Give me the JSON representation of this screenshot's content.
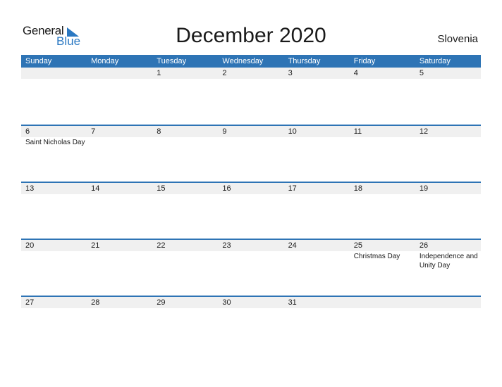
{
  "logo": {
    "general": "General",
    "blue": "Blue"
  },
  "header": {
    "title": "December 2020",
    "country": "Slovenia"
  },
  "colors": {
    "accent": "#2e74b5",
    "row_bg": "#f0f0f0"
  },
  "days": [
    "Sunday",
    "Monday",
    "Tuesday",
    "Wednesday",
    "Thursday",
    "Friday",
    "Saturday"
  ],
  "weeks": [
    {
      "dates": [
        "",
        "",
        "1",
        "2",
        "3",
        "4",
        "5"
      ],
      "events": [
        "",
        "",
        "",
        "",
        "",
        "",
        ""
      ]
    },
    {
      "dates": [
        "6",
        "7",
        "8",
        "9",
        "10",
        "11",
        "12"
      ],
      "events": [
        "Saint Nicholas Day",
        "",
        "",
        "",
        "",
        "",
        ""
      ]
    },
    {
      "dates": [
        "13",
        "14",
        "15",
        "16",
        "17",
        "18",
        "19"
      ],
      "events": [
        "",
        "",
        "",
        "",
        "",
        "",
        ""
      ]
    },
    {
      "dates": [
        "20",
        "21",
        "22",
        "23",
        "24",
        "25",
        "26"
      ],
      "events": [
        "",
        "",
        "",
        "",
        "",
        "Christmas Day",
        "Independence and Unity Day"
      ]
    },
    {
      "dates": [
        "27",
        "28",
        "29",
        "30",
        "31",
        "",
        ""
      ],
      "events": [
        "",
        "",
        "",
        "",
        "",
        "",
        ""
      ]
    }
  ]
}
